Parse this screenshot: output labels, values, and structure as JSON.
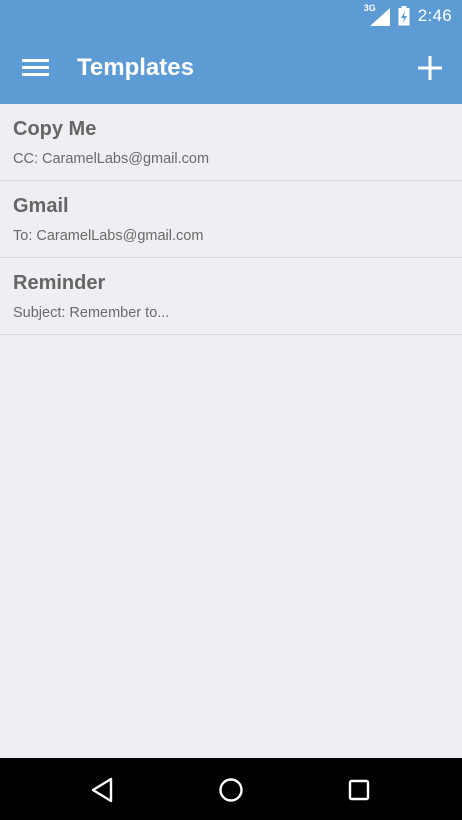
{
  "status_bar": {
    "network": "3G",
    "time": "2:46"
  },
  "app_bar": {
    "title": "Templates",
    "menu_icon": "hamburger-menu-icon",
    "add_icon": "plus-icon"
  },
  "templates": [
    {
      "title": "Copy Me",
      "detail": "CC: CaramelLabs@gmail.com"
    },
    {
      "title": "Gmail",
      "detail": "To: CaramelLabs@gmail.com"
    },
    {
      "title": "Reminder",
      "detail": "Subject: Remember to..."
    }
  ],
  "nav_bar": {
    "back_icon": "back-triangle-icon",
    "home_icon": "home-circle-icon",
    "recents_icon": "recents-square-icon"
  },
  "colors": {
    "primary": "#5c9bd4",
    "background": "#efeef2",
    "title_text": "#666666",
    "divider": "#d6d6da"
  }
}
